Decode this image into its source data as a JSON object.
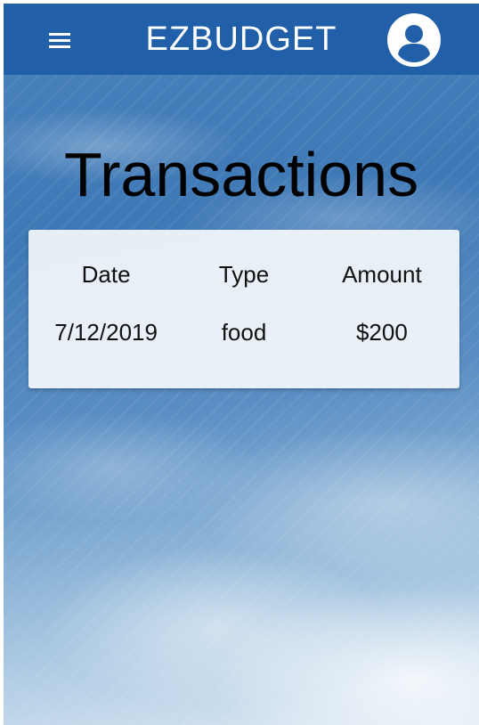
{
  "app": {
    "title": "EZBUDGET",
    "menu_icon": "menu-icon",
    "account_icon": "account-circle-icon",
    "bar_color": "#2160a8"
  },
  "page": {
    "heading": "Transactions"
  },
  "transactions": {
    "headers": [
      "Date",
      "Type",
      "Amount"
    ],
    "rows": [
      [
        "7/12/2019",
        "food",
        "$200"
      ]
    ]
  }
}
